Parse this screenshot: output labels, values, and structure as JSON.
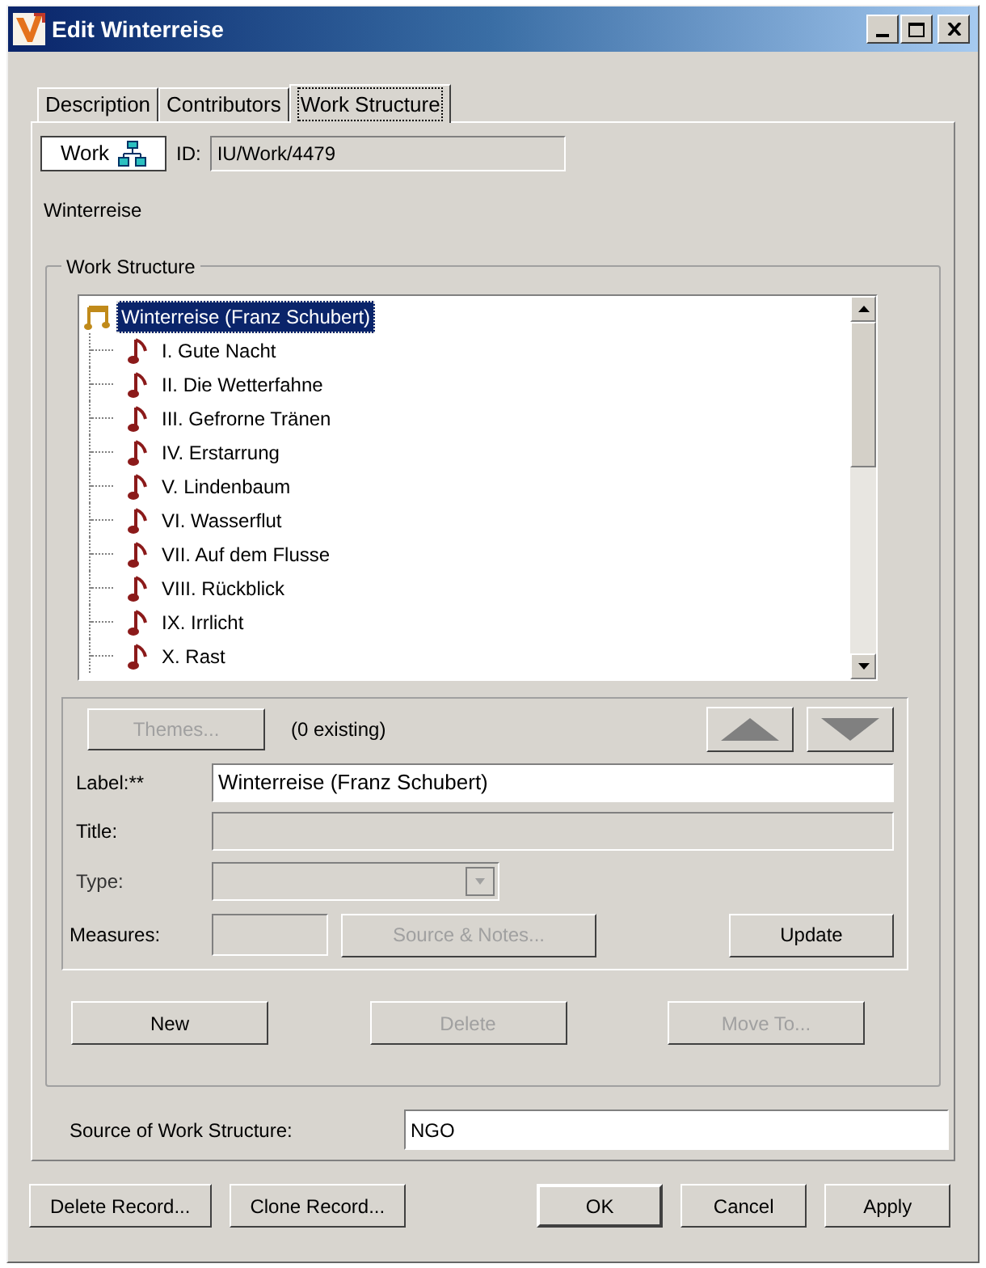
{
  "window": {
    "title": "Edit Winterreise"
  },
  "tabs": [
    {
      "label": "Description",
      "selected": false
    },
    {
      "label": "Contributors",
      "selected": false
    },
    {
      "label": "Work Structure",
      "selected": true
    }
  ],
  "header": {
    "type_button": "Work",
    "id_label": "ID:",
    "id_value": "IU/Work/4479",
    "heading": "Winterreise"
  },
  "work_structure": {
    "title": "Work Structure",
    "tree": [
      {
        "label": "Winterreise (Franz Schubert)",
        "selected": true,
        "children": [
          {
            "label": "I. Gute Nacht",
            "selected": false
          },
          {
            "label": "II. Die Wetterfahne",
            "selected": false
          },
          {
            "label": "III. Gefrorne Tränen",
            "selected": false
          },
          {
            "label": "IV. Erstarrung",
            "selected": false
          },
          {
            "label": "V. Lindenbaum",
            "selected": false
          },
          {
            "label": "VI. Wasserflut",
            "selected": false
          },
          {
            "label": "VII. Auf dem Flusse",
            "selected": false
          },
          {
            "label": "VIII. Rückblick",
            "selected": false
          },
          {
            "label": "IX. Irrlicht",
            "selected": false
          },
          {
            "label": "X. Rast",
            "selected": false
          }
        ]
      }
    ],
    "themes_button": {
      "label": "Themes...",
      "disabled": true
    },
    "themes_count": "(0 existing)",
    "fields": [
      {
        "label": "Label:**",
        "value": "Winterreise (Franz Schubert)",
        "disabled": false
      },
      {
        "label": "Title:",
        "disabled": true
      }
    ],
    "type": {
      "label": "Type:",
      "disabled": true
    },
    "measures": {
      "label": "Measures:",
      "disabled": true
    },
    "source_notes_button": {
      "label": "Source & Notes...",
      "disabled": true
    },
    "update_button": {
      "label": "Update",
      "disabled": false
    },
    "actions": [
      {
        "label": "New",
        "disabled": false
      },
      {
        "label": "Delete",
        "disabled": true
      },
      {
        "label": "Move To...",
        "disabled": true
      }
    ]
  },
  "source": {
    "label": "Source of Work Structure:",
    "value": "NGO"
  },
  "footer_buttons": [
    {
      "label": "Delete Record..."
    },
    {
      "label": "Clone Record..."
    },
    {
      "label": "OK"
    },
    {
      "label": "Cancel"
    },
    {
      "label": "Apply"
    }
  ]
}
